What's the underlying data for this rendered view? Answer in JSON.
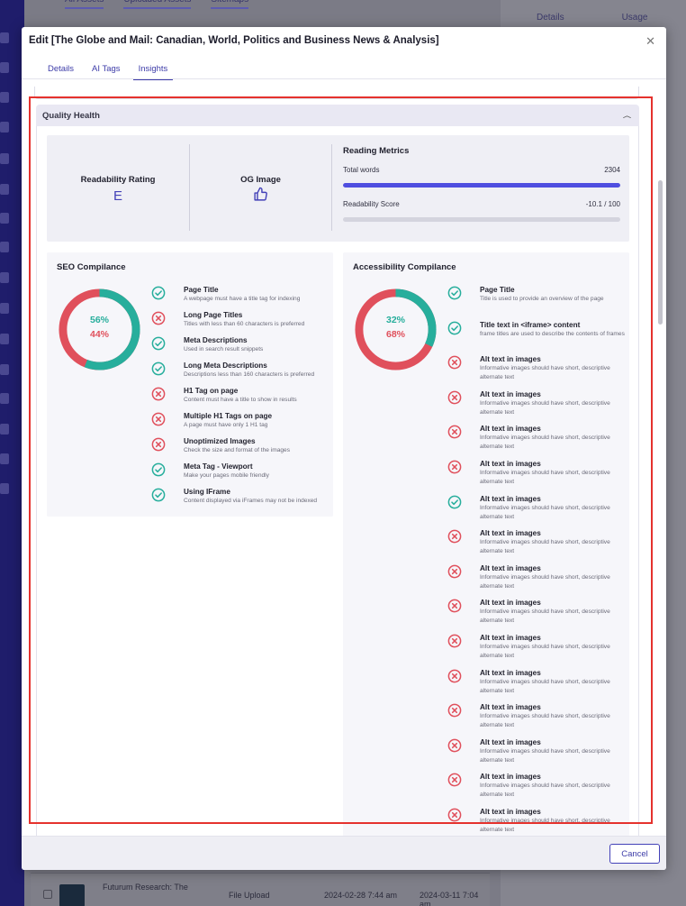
{
  "background": {
    "tabs": [
      "All Assets",
      "Uploaded Assets",
      "Sitemaps"
    ],
    "right_tabs": [
      "Details",
      "Usage"
    ],
    "row": {
      "name": "Futurum Research: The",
      "source": "File Upload",
      "created": "2024-02-28 7:44 am",
      "modified": "2024-03-11 7:04 am"
    }
  },
  "modal": {
    "title": "Edit [The Globe and Mail: Canadian, World, Politics and Business News & Analysis]",
    "close_icon": "close-icon",
    "tabs": [
      {
        "label": "Details",
        "active": false
      },
      {
        "label": "AI Tags",
        "active": false
      },
      {
        "label": "Insights",
        "active": true
      }
    ],
    "cancel_label": "Cancel"
  },
  "quality_health": {
    "title": "Quality Health",
    "readability": {
      "label": "Readability Rating",
      "grade": "E"
    },
    "og_image": {
      "label": "OG Image",
      "icon": "thumbs-up-icon"
    },
    "reading_metrics": {
      "title": "Reading Metrics",
      "total_words_label": "Total words",
      "total_words": "2304",
      "total_words_fill": 1.0,
      "readability_score_label": "Readability Score",
      "readability_score": "-10.1 / 100",
      "readability_score_fill": 0.0
    },
    "seo": {
      "title": "SEO Compilance",
      "pass_pct": "56%",
      "fail_pct": "44%",
      "pass_fraction": 0.56,
      "items": [
        {
          "title": "Page Title",
          "desc": "A webpage must have a title tag for indexing",
          "status": "pass"
        },
        {
          "title": "Long Page Titles",
          "desc": "Titles with less than 60 characters is preferred",
          "status": "fail"
        },
        {
          "title": "Meta Descriptions",
          "desc": "Used in search result snippets",
          "status": "pass"
        },
        {
          "title": "Long Meta Descriptions",
          "desc": "Descriptions less than 160 characters is preferred",
          "status": "pass"
        },
        {
          "title": "H1 Tag on page",
          "desc": "Content must have a title to show in results",
          "status": "fail"
        },
        {
          "title": "Multiple H1 Tags on page",
          "desc": "A page must have only 1 H1 tag",
          "status": "fail"
        },
        {
          "title": "Unoptimized Images",
          "desc": "Check the size and format of the images",
          "status": "fail"
        },
        {
          "title": "Meta Tag - Viewport",
          "desc": "Make your pages mobile friendly",
          "status": "pass"
        },
        {
          "title": "Using IFrame",
          "desc": "Content displayed via iFrames may not be indexed",
          "status": "pass"
        }
      ]
    },
    "accessibility": {
      "title": "Accessibility Compilance",
      "pass_pct": "32%",
      "fail_pct": "68%",
      "pass_fraction": 0.32,
      "items": [
        {
          "title": "Page Title",
          "desc": "Title is used to provide an overview of the page",
          "status": "pass"
        },
        {
          "title": "Title text in <iframe> content",
          "desc": "frame titles are used to describe the contents of frames",
          "status": "pass"
        },
        {
          "title": "Alt text in images",
          "desc": "Informative images should have short, descriptive alternate text",
          "status": "fail"
        },
        {
          "title": "Alt text in images",
          "desc": "Informative images should have short, descriptive alternate text",
          "status": "fail"
        },
        {
          "title": "Alt text in images",
          "desc": "Informative images should have short, descriptive alternate text",
          "status": "fail"
        },
        {
          "title": "Alt text in images",
          "desc": "Informative images should have short, descriptive alternate text",
          "status": "fail"
        },
        {
          "title": "Alt text in images",
          "desc": "Informative images should have short, descriptive alternate text",
          "status": "pass"
        },
        {
          "title": "Alt text in images",
          "desc": "Informative images should have short, descriptive alternate text",
          "status": "fail"
        },
        {
          "title": "Alt text in images",
          "desc": "Informative images should have short, descriptive alternate text",
          "status": "fail"
        },
        {
          "title": "Alt text in images",
          "desc": "Informative images should have short, descriptive alternate text",
          "status": "fail"
        },
        {
          "title": "Alt text in images",
          "desc": "Informative images should have short, descriptive alternate text",
          "status": "fail"
        },
        {
          "title": "Alt text in images",
          "desc": "Informative images should have short, descriptive alternate text",
          "status": "fail"
        },
        {
          "title": "Alt text in images",
          "desc": "Informative images should have short, descriptive alternate text",
          "status": "fail"
        },
        {
          "title": "Alt text in images",
          "desc": "Informative images should have short, descriptive alternate text",
          "status": "fail"
        },
        {
          "title": "Alt text in images",
          "desc": "Informative images should have short, descriptive alternate text",
          "status": "fail"
        },
        {
          "title": "Alt text in images",
          "desc": "Informative images should have short, descriptive alternate text",
          "status": "fail"
        }
      ]
    }
  },
  "colors": {
    "pass": "#27ae9c",
    "fail": "#e0505c",
    "accent": "#4341b8",
    "annotation": "#e5322d"
  }
}
